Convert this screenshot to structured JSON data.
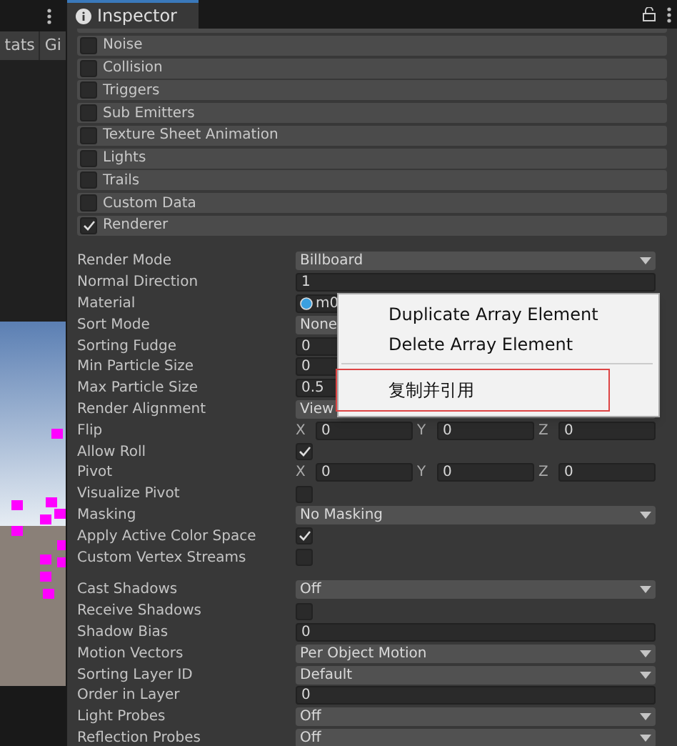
{
  "left_panel": {
    "tabs": [
      {
        "label": "tats",
        "selected": false
      },
      {
        "label": "Gi",
        "selected": false
      }
    ]
  },
  "inspector": {
    "title": "Inspector",
    "locked": false
  },
  "modules": [
    {
      "label": "Noise",
      "checked": false
    },
    {
      "label": "Collision",
      "checked": false
    },
    {
      "label": "Triggers",
      "checked": false
    },
    {
      "label": "Sub Emitters",
      "checked": false
    },
    {
      "label": "Texture Sheet Animation",
      "checked": false
    },
    {
      "label": "Lights",
      "checked": false
    },
    {
      "label": "Trails",
      "checked": false
    },
    {
      "label": "Custom Data",
      "checked": false
    },
    {
      "label": "Renderer",
      "checked": true
    }
  ],
  "properties": [
    {
      "kind": "dropdown",
      "label": "Render Mode",
      "value": "Billboard"
    },
    {
      "kind": "field",
      "label": "Normal Direction",
      "value": "1"
    },
    {
      "kind": "object",
      "label": "Material",
      "value": "m0"
    },
    {
      "kind": "dropdown",
      "label": "Sort Mode",
      "value": "None"
    },
    {
      "kind": "field",
      "label": "Sorting Fudge",
      "value": "0"
    },
    {
      "kind": "field",
      "label": "Min Particle Size",
      "value": "0"
    },
    {
      "kind": "field",
      "label": "Max Particle Size",
      "value": "0.5"
    },
    {
      "kind": "dropdown",
      "label": "Render Alignment",
      "value": "View"
    },
    {
      "kind": "vector",
      "label": "Flip",
      "axes": [
        {
          "axis": "X",
          "value": "0"
        },
        {
          "axis": "Y",
          "value": "0"
        },
        {
          "axis": "Z",
          "value": "0"
        }
      ]
    },
    {
      "kind": "check",
      "label": "Allow Roll",
      "checked": true
    },
    {
      "kind": "vector",
      "label": "Pivot",
      "axes": [
        {
          "axis": "X",
          "value": "0"
        },
        {
          "axis": "Y",
          "value": "0"
        },
        {
          "axis": "Z",
          "value": "0"
        }
      ]
    },
    {
      "kind": "check",
      "label": "Visualize Pivot",
      "checked": false
    },
    {
      "kind": "dropdown",
      "label": "Masking",
      "value": "No Masking"
    },
    {
      "kind": "check",
      "label": "Apply Active Color Space",
      "checked": true
    },
    {
      "kind": "check",
      "label": "Custom Vertex Streams",
      "checked": false
    },
    {
      "kind": "spacer"
    },
    {
      "kind": "dropdown",
      "label": "Cast Shadows",
      "value": "Off"
    },
    {
      "kind": "check",
      "label": "Receive Shadows",
      "checked": false
    },
    {
      "kind": "field",
      "label": "Shadow Bias",
      "value": "0"
    },
    {
      "kind": "dropdown",
      "label": "Motion Vectors",
      "value": "Per Object Motion"
    },
    {
      "kind": "dropdown",
      "label": "Sorting Layer ID",
      "value": "Default"
    },
    {
      "kind": "field",
      "label": "Order in Layer",
      "value": "0"
    },
    {
      "kind": "dropdown",
      "label": "Light Probes",
      "value": "Off"
    },
    {
      "kind": "dropdown",
      "label": "Reflection Probes",
      "value": "Off"
    }
  ],
  "context_menu": {
    "items": [
      {
        "kind": "item",
        "label": "Duplicate Array Element",
        "highlighted": false
      },
      {
        "kind": "item",
        "label": "Delete Array Element",
        "highlighted": false
      },
      {
        "kind": "separator"
      },
      {
        "kind": "item",
        "label": "复制并引用",
        "highlighted": true
      }
    ]
  }
}
